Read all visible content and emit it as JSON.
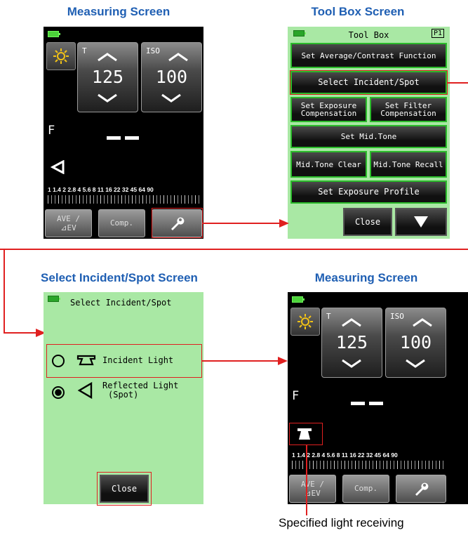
{
  "headings": {
    "measuring_1": "Measuring Screen",
    "toolbox": "Tool Box Screen",
    "select": "Select Incident/Spot Screen",
    "measuring_2": "Measuring Screen"
  },
  "measuring": {
    "t_label": "T",
    "t_value": "125",
    "iso_label": "ISO",
    "iso_value": "100",
    "f_label": "F",
    "scale": "1  1.4  2  2.8  4  5.6  8   11  16  22  32  45  64  90",
    "ave_label_1": "AVE /",
    "ave_label_2": "⊿EV",
    "comp_label": "Comp."
  },
  "toolbox": {
    "title": "Tool Box",
    "page": "P1",
    "items": [
      "Set Average/Contrast Function",
      "Select Incident/Spot",
      "Set Exposure Compensation",
      "Set Filter Compensation",
      "Set Mid.Tone",
      "Mid.Tone Clear",
      "Mid.Tone Recall",
      "Set Exposure Profile"
    ],
    "close": "Close"
  },
  "select_screen": {
    "title": "Select Incident/Spot",
    "incident": "Incident Light",
    "reflected_1": "Reflected Light",
    "reflected_2": "(Spot)",
    "close": "Close"
  },
  "caption": "Specified light receiving",
  "colors": {
    "accent_heading": "#1f5fb3",
    "highlight": "#e02020",
    "toolbox_bg": "#a9e8a4",
    "button_border": "#2bbb2b"
  }
}
